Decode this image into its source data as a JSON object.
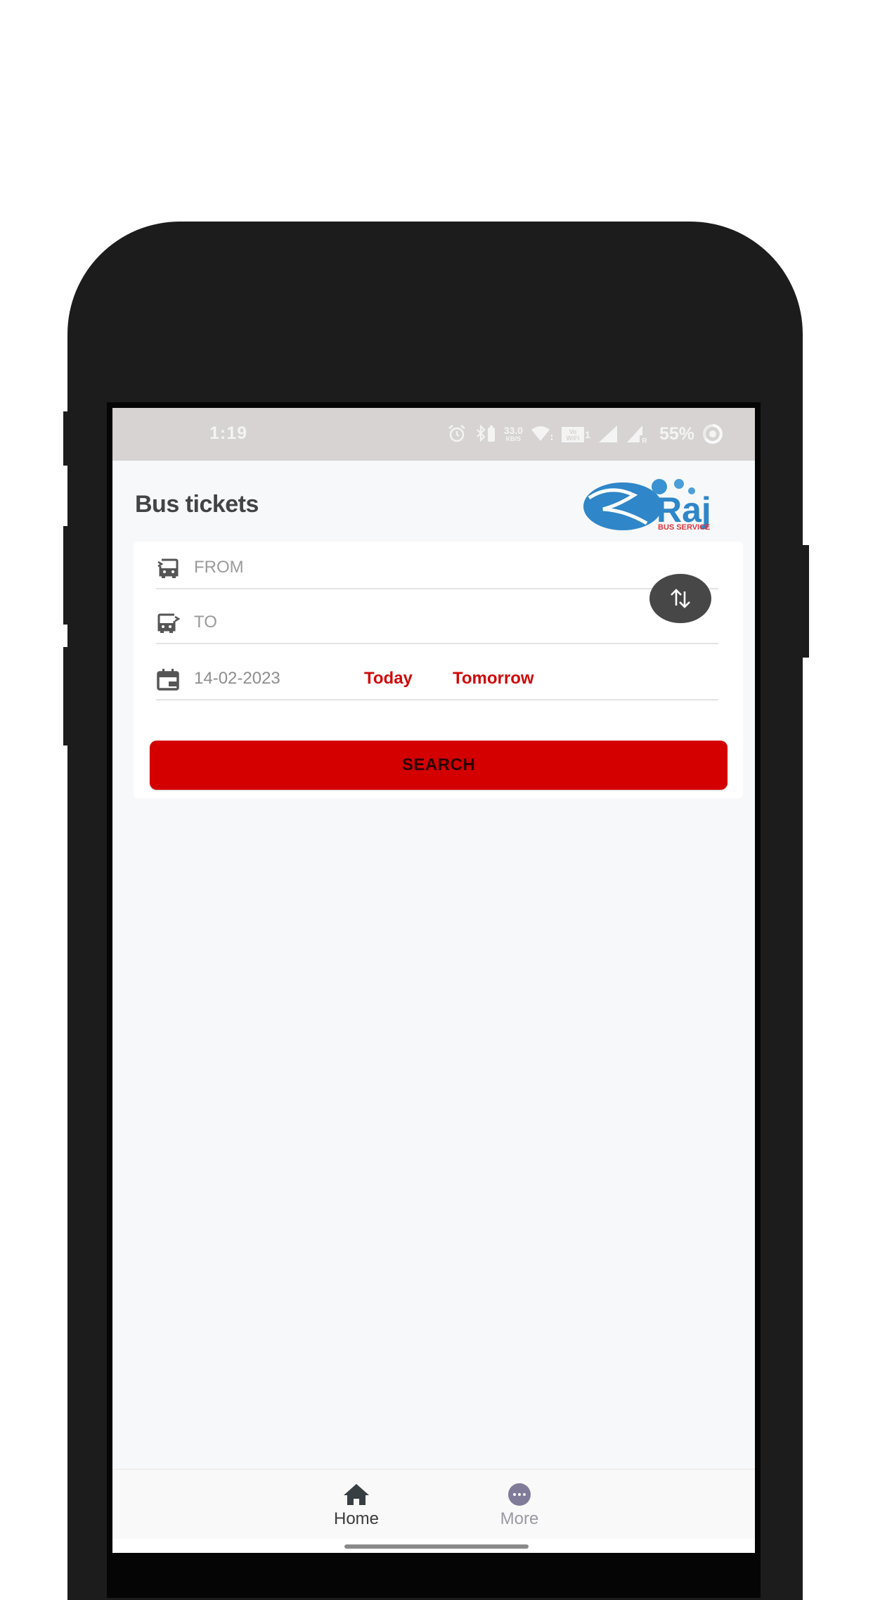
{
  "status_bar": {
    "time": "1:19",
    "net_speed_value": "33.0",
    "net_speed_unit": "KB/S",
    "vowifi_label": "Vo WiFi 1",
    "roaming_label": "R",
    "battery": "55%"
  },
  "header": {
    "title": "Bus tickets",
    "logo_text": "Raj",
    "logo_subtitle": "BUS SERVICE"
  },
  "search_form": {
    "from_placeholder": "FROM",
    "to_placeholder": "TO",
    "date_value": "14-02-2023",
    "today_label": "Today",
    "tomorrow_label": "Tomorrow",
    "search_label": "SEARCH"
  },
  "bottom_nav": {
    "items": [
      {
        "label": "Home",
        "icon": "home-icon",
        "active": true
      },
      {
        "label": "More",
        "icon": "more-icon",
        "active": false
      }
    ]
  },
  "colors": {
    "accent_red": "#d40000",
    "logo_blue": "#2f86c8",
    "status_bar_bg": "#d6d3d2",
    "more_icon_bg": "#7f7b98"
  }
}
